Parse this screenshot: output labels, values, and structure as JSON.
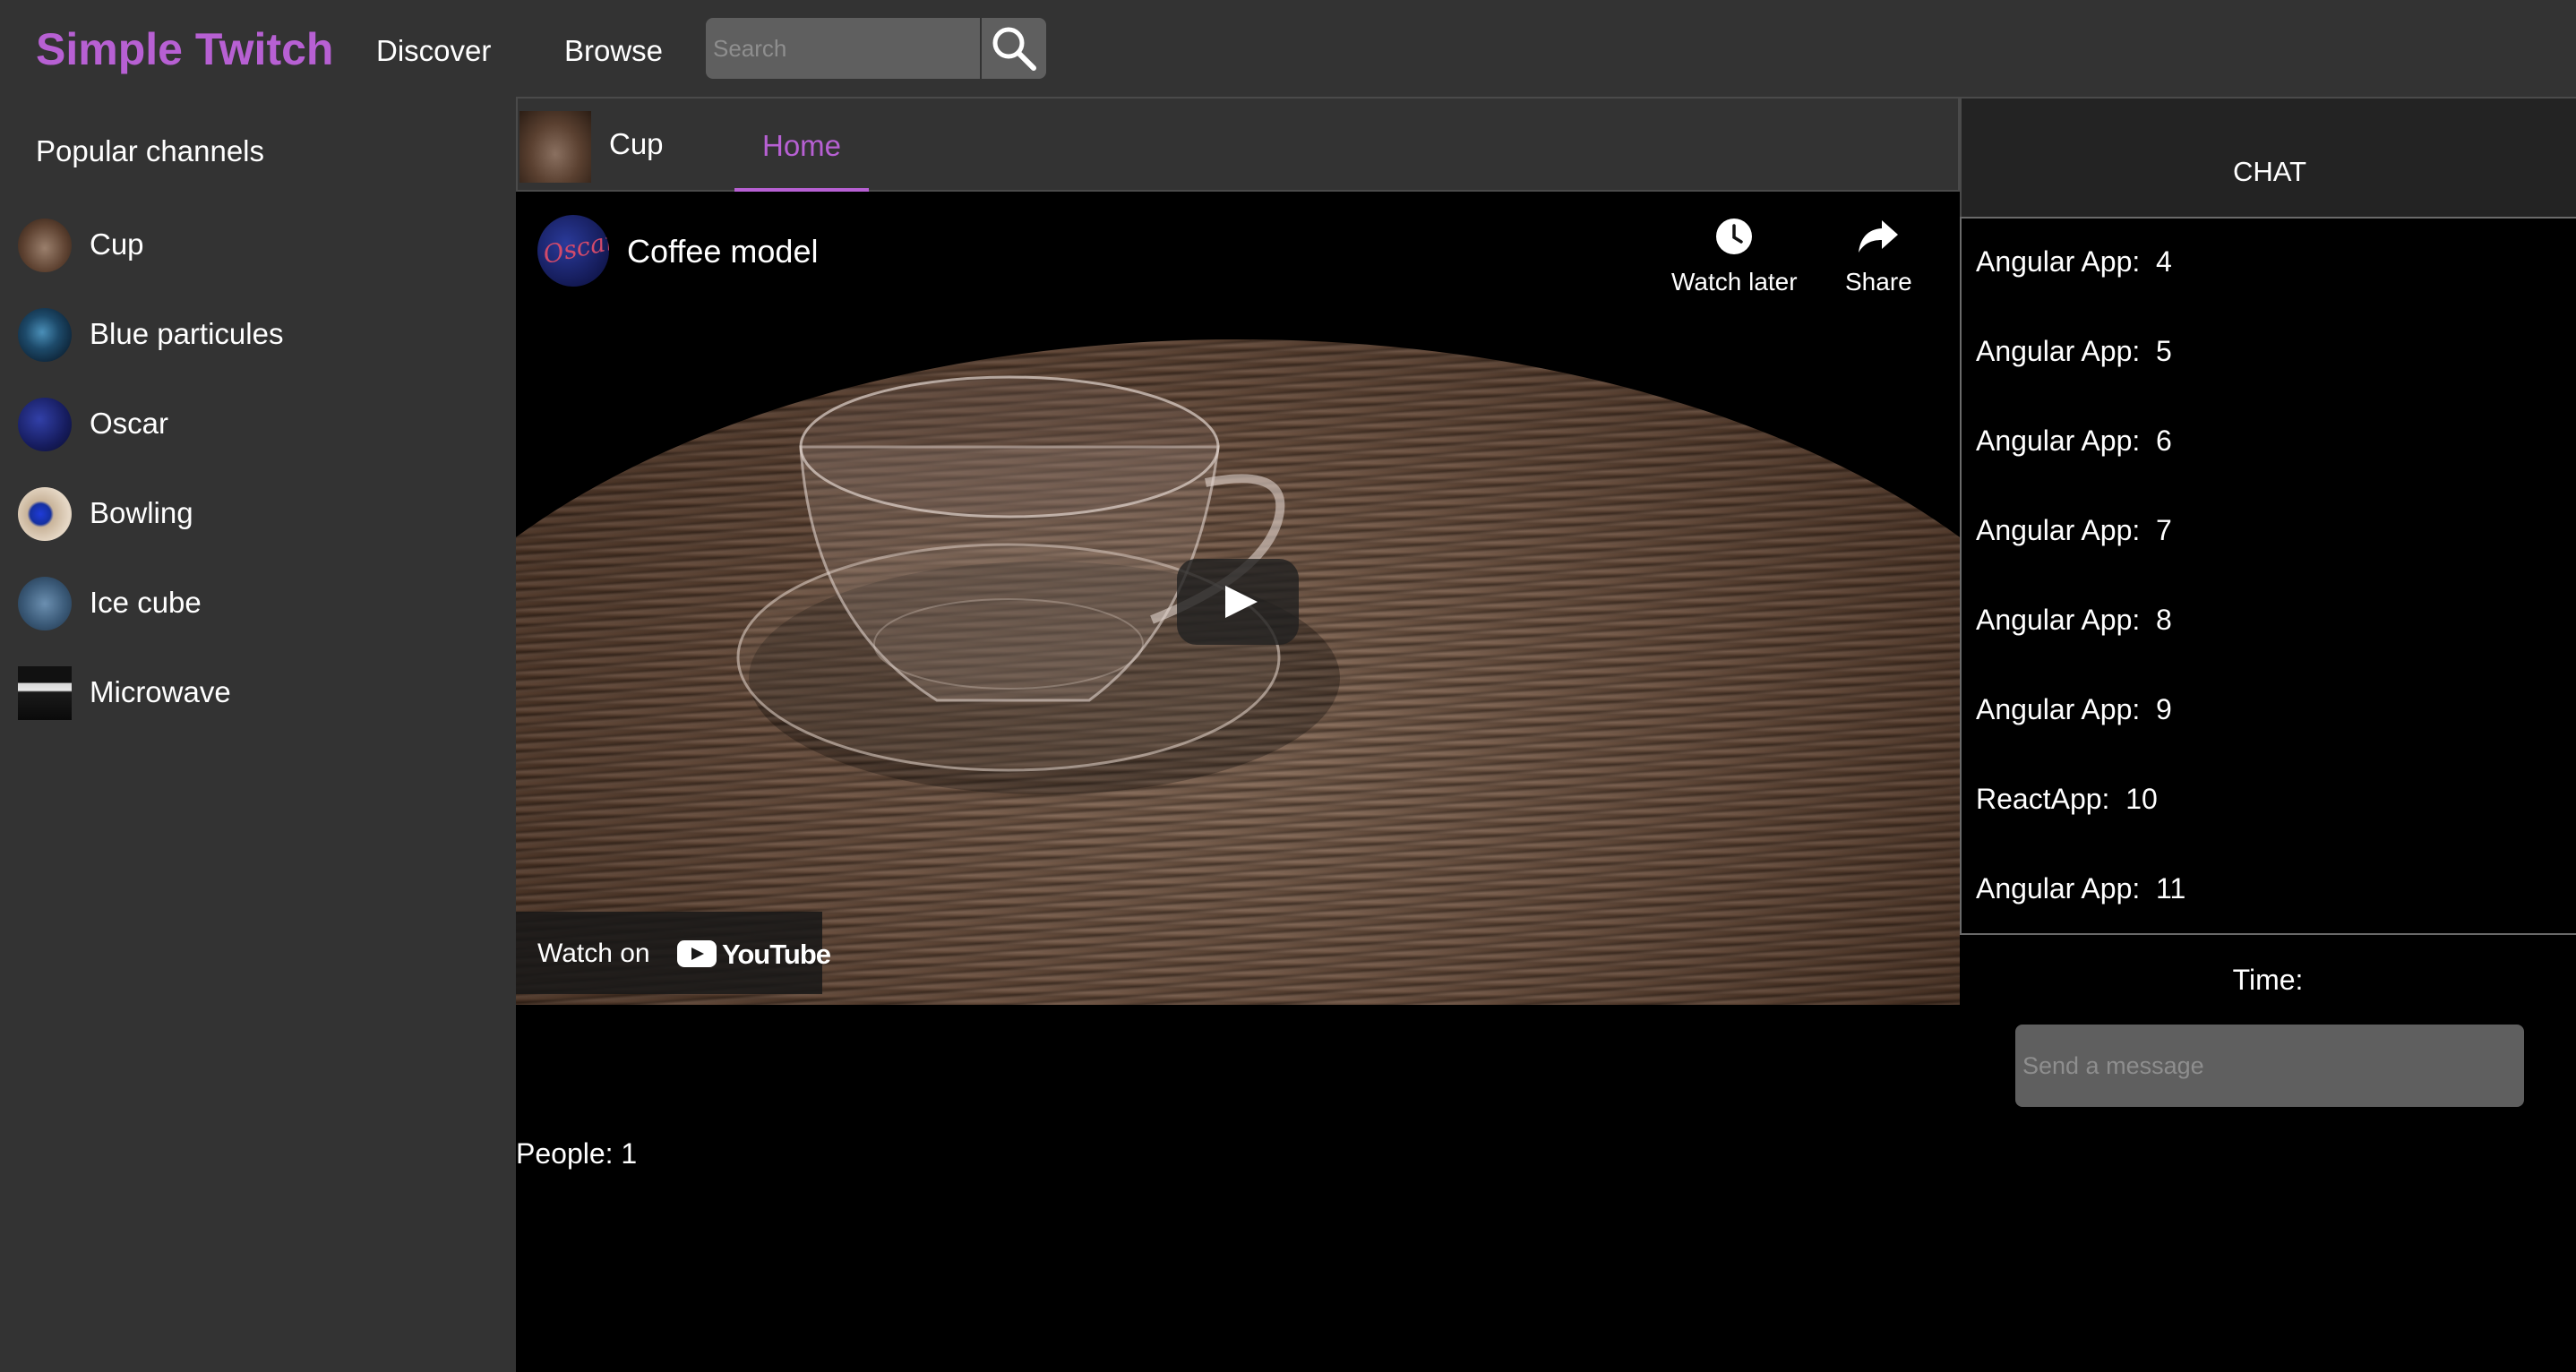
{
  "header": {
    "brand": "Simple Twitch",
    "nav": [
      "Discover",
      "Browse"
    ],
    "search": {
      "placeholder": "Search",
      "value": ""
    }
  },
  "sidebar": {
    "heading": "Popular channels",
    "channels": [
      {
        "label": "Cup"
      },
      {
        "label": "Blue particules"
      },
      {
        "label": "Oscar"
      },
      {
        "label": "Bowling"
      },
      {
        "label": "Ice cube"
      },
      {
        "label": "Microwave"
      }
    ]
  },
  "channel_tabs": {
    "channel_name": "Cup",
    "active_tab": "Home"
  },
  "video": {
    "title": "Coffee model",
    "channel_avatar_text": "Oscar",
    "watch_later": "Watch later",
    "share": "Share",
    "watch_on": "Watch on",
    "youtube": "YouTube"
  },
  "people": "People: 1",
  "chat": {
    "header": "CHAT",
    "messages": [
      "Angular App:  4",
      "Angular App:  5",
      "Angular App:  6",
      "Angular App:  7",
      "Angular App:  8",
      "Angular App:  9",
      "ReactApp:  10",
      "Angular App:  11"
    ],
    "time_label": "Time:",
    "input_placeholder": "Send a message"
  },
  "colors": {
    "accent": "#b760d3",
    "panel": "#333333",
    "background": "#000000",
    "input": "#5f5f5f"
  }
}
